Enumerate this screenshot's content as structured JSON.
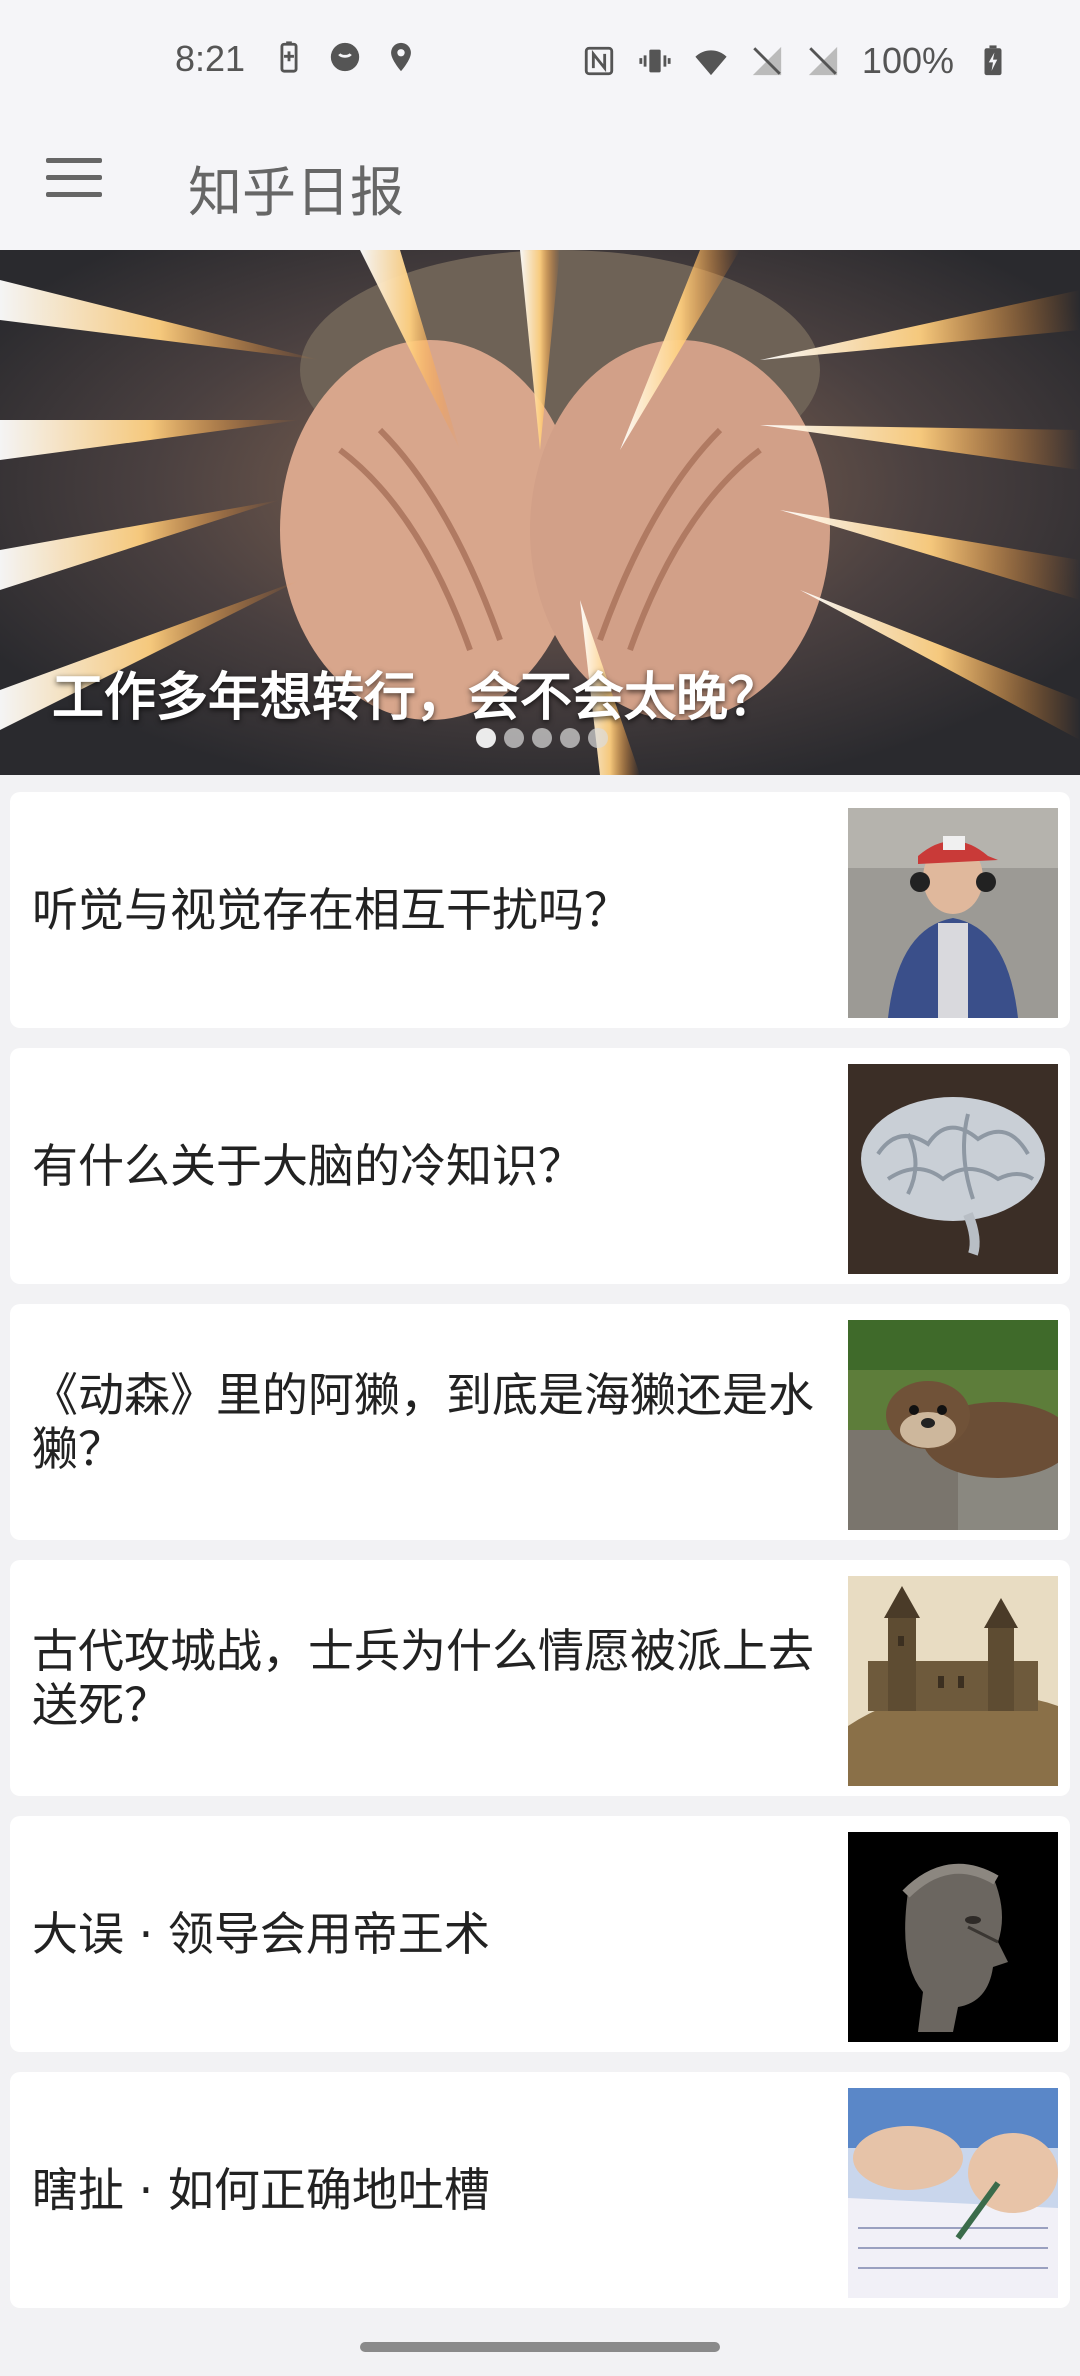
{
  "status_bar": {
    "time": "8:21",
    "battery": "100%",
    "left_icons": [
      "battery-saver-icon",
      "face-icon",
      "location-icon"
    ],
    "right_icons": [
      "nfc-icon",
      "vibrate-icon",
      "wifi-icon",
      "no-sim-icon",
      "no-sim-icon",
      "battery-charging-icon"
    ]
  },
  "app_bar": {
    "title": "知乎日报",
    "menu_icon": "hamburger-menu-icon"
  },
  "hero": {
    "title": "工作多年想转行，会不会太晚？",
    "dot_count": 5,
    "active_dot": 0
  },
  "stories": [
    {
      "title": "听觉与视觉存在相互干扰吗？",
      "thumb": "boy-with-headphones"
    },
    {
      "title": "有什么关于大脑的冷知识？",
      "thumb": "brain-model"
    },
    {
      "title": "《动森》里的阿獭，到底是海獭还是水獭？",
      "thumb": "otter"
    },
    {
      "title": "古代攻城战，士兵为什么情愿被派上去送死？",
      "thumb": "castle"
    },
    {
      "title": "大误 · 领导会用帝王术",
      "thumb": "caesar-bust"
    },
    {
      "title": "瞎扯 · 如何正确地吐槽",
      "thumb": "writing-hands"
    }
  ],
  "colors": {
    "background": "#f2f2f4",
    "card": "#ffffff",
    "text": "#222222",
    "app_title": "#666666"
  }
}
